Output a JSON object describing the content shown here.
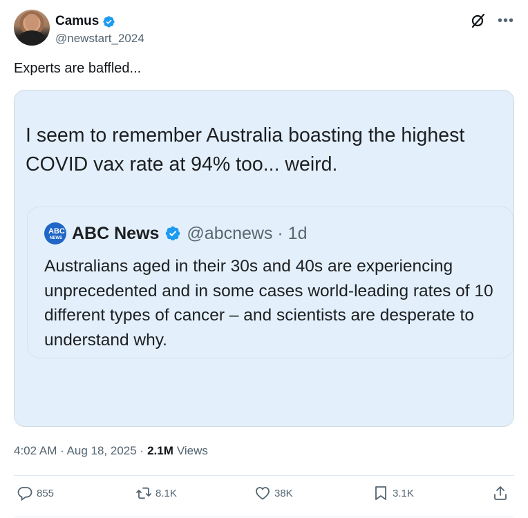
{
  "author": {
    "name": "Camus",
    "handle": "@newstart_2024"
  },
  "tweet": {
    "text": "Experts are baffled..."
  },
  "media": {
    "text": "I seem to remember Australia boasting the highest COVID vax rate at 94% too... weird.",
    "quote": {
      "name": "ABC News",
      "handle": "@abcnews · 1d",
      "text": "Australians aged in their 30s and 40s are experiencing unprecedented and in some cases world-leading rates of 10 different types of cancer – and scientists are desperate to understand why."
    }
  },
  "meta": {
    "time": "4:02 AM · Aug 18, 2025 ·",
    "views_count": "2.1M",
    "views_label": "Views"
  },
  "actions": {
    "replies": "855",
    "reposts": "8.1K",
    "likes": "38K",
    "bookmarks": "3.1K"
  },
  "colors": {
    "verified": "#1d9bf0",
    "text_secondary": "#536471",
    "media_bg": "#e3f0fb"
  },
  "icons": [
    "verified-badge-icon",
    "grok-icon",
    "more-icon",
    "reply-icon",
    "repost-icon",
    "like-icon",
    "bookmark-icon",
    "share-icon"
  ]
}
